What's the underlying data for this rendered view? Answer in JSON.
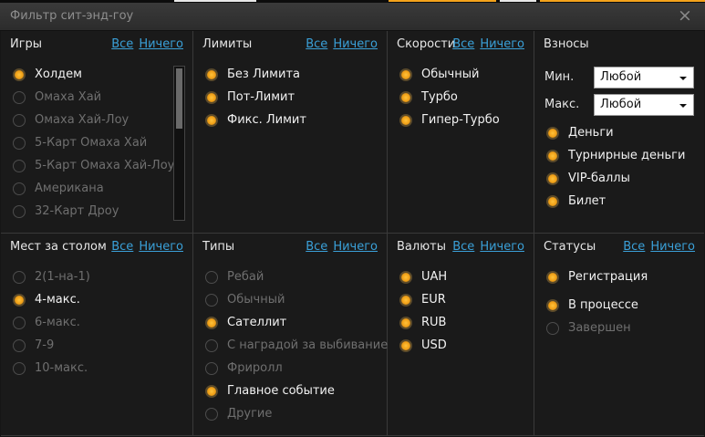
{
  "window": {
    "title": "Фильтр сит-энд-гоу",
    "close_glyph": "×"
  },
  "common": {
    "all": "Все",
    "none": "Ничего"
  },
  "games": {
    "header": "Игры",
    "items": [
      {
        "label": "Холдем",
        "selected": true
      },
      {
        "label": "Омаха Хай",
        "selected": false
      },
      {
        "label": "Омаха Хай-Лоу",
        "selected": false
      },
      {
        "label": "5-Карт Омаха Хай",
        "selected": false
      },
      {
        "label": "5-Карт Омаха Хай-Лоу",
        "selected": false
      },
      {
        "label": "Американа",
        "selected": false
      },
      {
        "label": "32-Карт Дроу",
        "selected": false
      }
    ]
  },
  "limits": {
    "header": "Лимиты",
    "items": [
      {
        "label": "Без Лимита",
        "selected": true
      },
      {
        "label": "Пот-Лимит",
        "selected": true
      },
      {
        "label": "Фикс. Лимит",
        "selected": true
      }
    ]
  },
  "speeds": {
    "header": "Скорости",
    "items": [
      {
        "label": "Обычный",
        "selected": true
      },
      {
        "label": "Турбо",
        "selected": true
      },
      {
        "label": "Гипер-Турбо",
        "selected": true
      }
    ]
  },
  "buyins": {
    "header": "Взносы",
    "min_label": "Мин.",
    "min_value": "Любой",
    "max_label": "Макс.",
    "max_value": "Любой",
    "items": [
      {
        "label": "Деньги",
        "selected": true
      },
      {
        "label": "Турнирные деньги",
        "selected": true
      },
      {
        "label": "VIP-баллы",
        "selected": true
      },
      {
        "label": "Билет",
        "selected": true
      }
    ]
  },
  "seats": {
    "header": "Мест за столом",
    "items": [
      {
        "label": "2(1-на-1)",
        "selected": false
      },
      {
        "label": "4-макс.",
        "selected": true
      },
      {
        "label": "6-макс.",
        "selected": false
      },
      {
        "label": "7-9",
        "selected": false
      },
      {
        "label": "10-макс.",
        "selected": false
      }
    ]
  },
  "types": {
    "header": "Типы",
    "items": [
      {
        "label": "Ребай",
        "selected": false
      },
      {
        "label": "Обычный",
        "selected": false
      },
      {
        "label": "Сателлит",
        "selected": true
      },
      {
        "label": "С наградой за выбивание",
        "selected": false
      },
      {
        "label": "Фриролл",
        "selected": false
      },
      {
        "label": "Главное событие",
        "selected": true
      },
      {
        "label": "Другие",
        "selected": false
      }
    ]
  },
  "currencies": {
    "header": "Валюты",
    "items": [
      {
        "label": "UAH",
        "selected": true
      },
      {
        "label": "EUR",
        "selected": true
      },
      {
        "label": "RUB",
        "selected": true
      },
      {
        "label": "USD",
        "selected": true
      }
    ]
  },
  "statuses": {
    "header": "Статусы",
    "items": [
      {
        "label": "Регистрация",
        "selected": true
      },
      {
        "label": "В процессе",
        "selected": true
      },
      {
        "label": "Завершен",
        "selected": false
      }
    ]
  },
  "colors": {
    "accent": "#f0a018",
    "link": "#3aa0d8",
    "background": "#1a1a1a",
    "divider": "#3a3a3a"
  }
}
